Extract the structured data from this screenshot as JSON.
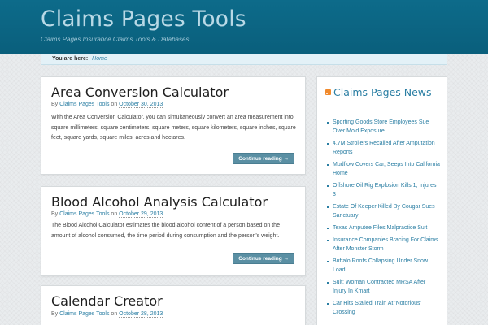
{
  "site": {
    "title": "Claims Pages Tools",
    "description": "Claims Pages Insurance Claims Tools & Databases"
  },
  "breadcrumb": {
    "label": "You are here:",
    "home": "Home"
  },
  "posts": [
    {
      "title": "Area Conversion Calculator",
      "by": "By",
      "author": "Claims Pages Tools",
      "on": "on",
      "date": "October 30, 2013",
      "excerpt": "With the Area Conversion Calculator, you can simultaneously convert an area measurement into square millimeters, square centimeters, square meters, square kilometers, square inches, square feet, square yards, square miles, acres and hectares.",
      "read_more": "Continue reading →"
    },
    {
      "title": "Blood Alcohol Analysis Calculator",
      "by": "By",
      "author": "Claims Pages Tools",
      "on": "on",
      "date": "October 29, 2013",
      "excerpt": "The Blood Alcohol Calculator estimates the blood alcohol content of a person based on the amount of alcohol consumed, the time period during consumption and the person's weight.",
      "read_more": "Continue reading →"
    },
    {
      "title": "Calendar Creator",
      "by": "By",
      "author": "Claims Pages Tools",
      "on": "on",
      "date": "October 28, 2013"
    }
  ],
  "sidebar": {
    "title": "Claims Pages News",
    "news": [
      "Sporting Goods Store Employees Sue Over Mold Exposure",
      "4.7M Strollers Recalled After Amputation Reports",
      "Mudflow Covers Car, Seeps Into California Home",
      "Offshore Oil Rig Explosion Kills 1, Injures 3",
      "Estate Of Keeper Killed By Cougar Sues Sanctuary",
      "Texas Amputee Files Malpractice Suit",
      "Insurance Companies Bracing For Claims After Monster Storm",
      "Buffalo Roofs Collapsing Under Snow Load",
      "Suit: Woman Contracted MRSA After Injury In Kmart",
      "Car Hits Stalled Train At 'Notorious' Crossing"
    ]
  },
  "colors": {
    "header": "#0a5f7c",
    "link": "#2a7ea3",
    "button": "#5a8fa3",
    "rss": "#f18a2c"
  }
}
